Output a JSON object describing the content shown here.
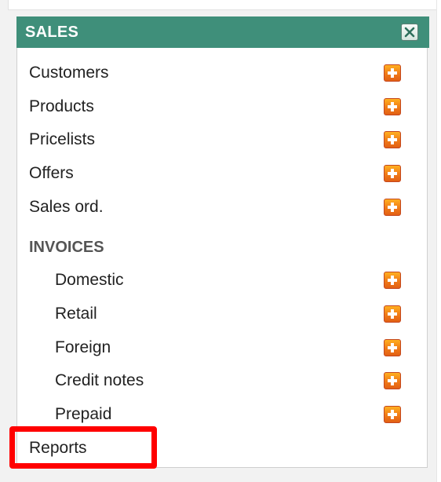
{
  "panel": {
    "title": "SALES",
    "colors": {
      "header": "#3f8f7a",
      "add_button": "#f07a18",
      "highlight": "#ff0000"
    }
  },
  "menu": {
    "customers": "Customers",
    "products": "Products",
    "pricelists": "Pricelists",
    "offers": "Offers",
    "sales_orders": "Sales ord.",
    "invoices_heading": "INVOICES",
    "domestic": "Domestic",
    "retail": "Retail",
    "foreign": "Foreign",
    "credit_notes": "Credit notes",
    "prepaid": "Prepaid",
    "reports": "Reports"
  },
  "icons": {
    "add": "plus-icon",
    "close": "close-icon"
  }
}
